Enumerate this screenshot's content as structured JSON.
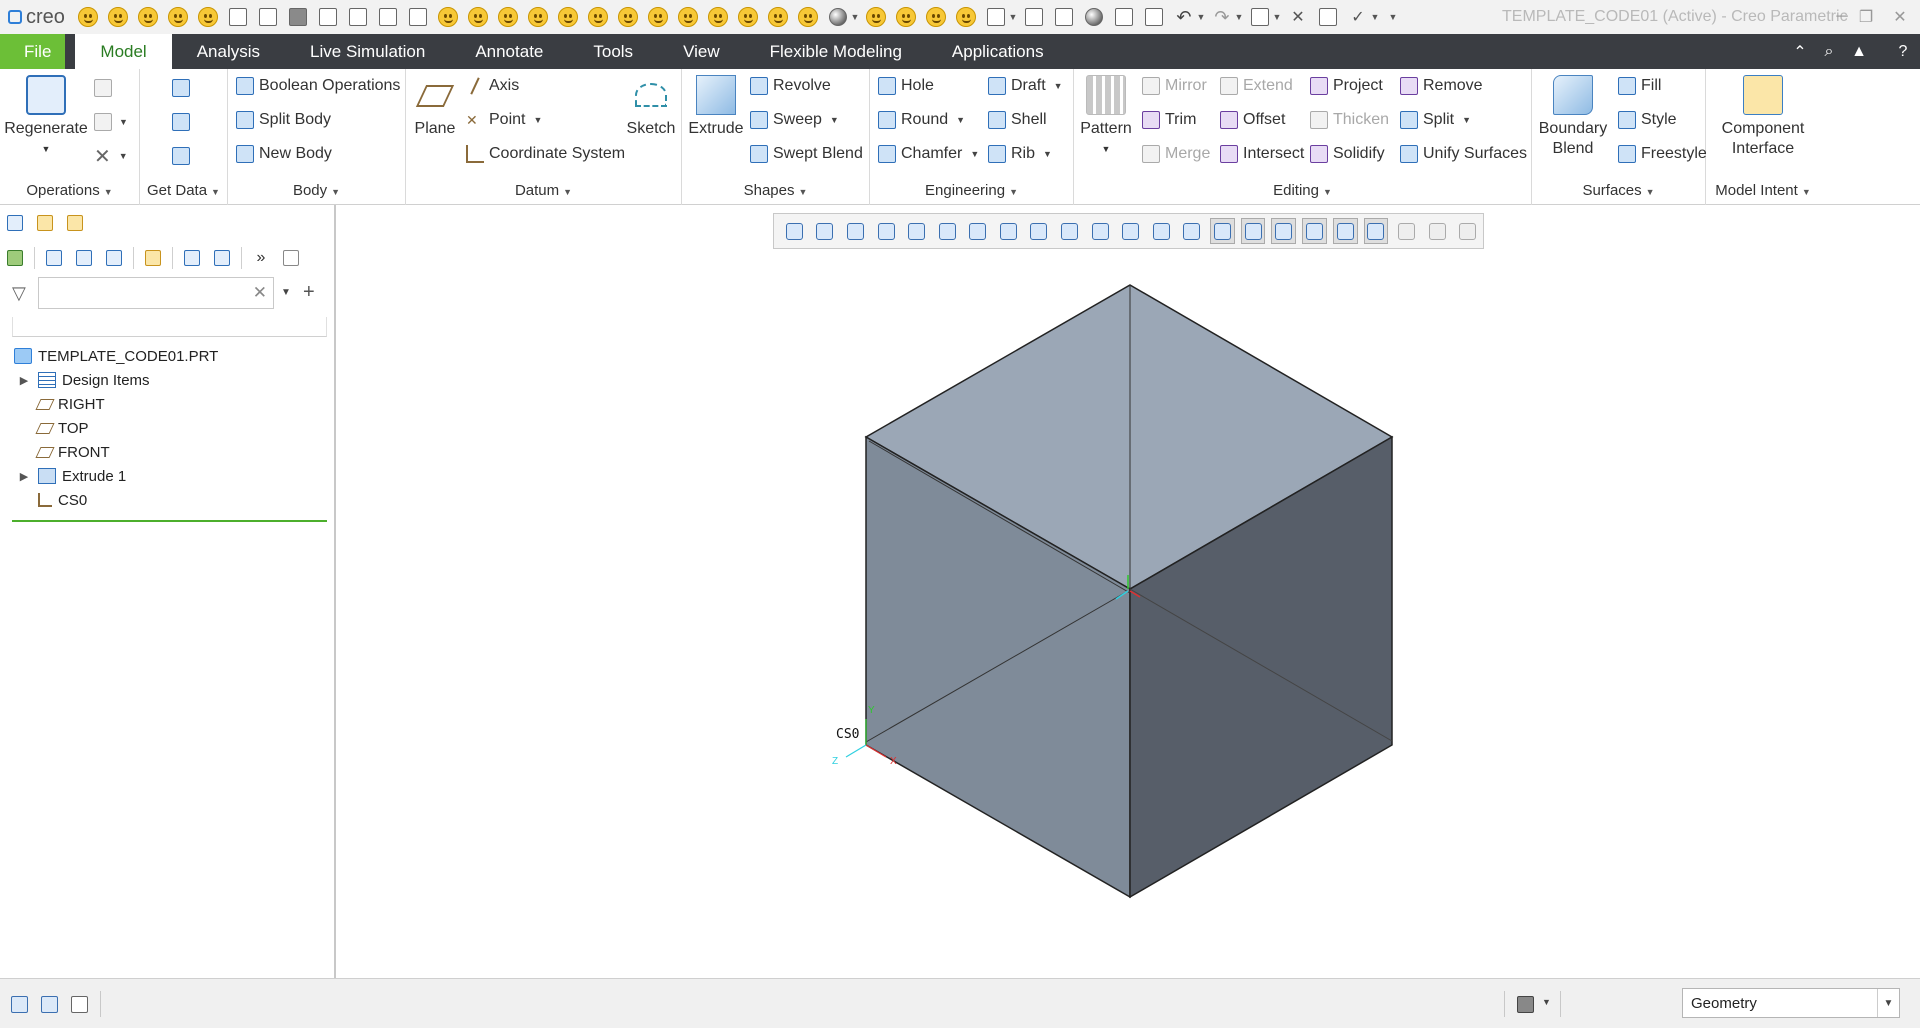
{
  "app": {
    "logo": "creo",
    "window_title": "TEMPLATE_CODE01 (Active) - Creo Parametric"
  },
  "tabs": [
    "File",
    "Model",
    "Analysis",
    "Live Simulation",
    "Annotate",
    "Tools",
    "View",
    "Flexible Modeling",
    "Applications"
  ],
  "active_tab": "Model",
  "ribbon": {
    "operations": {
      "regenerate": "Regenerate",
      "label": "Operations"
    },
    "get_data": {
      "label": "Get Data"
    },
    "body": {
      "boolean": "Boolean Operations",
      "split": "Split Body",
      "new": "New Body",
      "label": "Body"
    },
    "datum": {
      "plane": "Plane",
      "axis": "Axis",
      "point": "Point",
      "csys": "Coordinate System",
      "sketch": "Sketch",
      "label": "Datum"
    },
    "shapes": {
      "extrude": "Extrude",
      "revolve": "Revolve",
      "sweep": "Sweep",
      "swept_blend": "Swept Blend",
      "label": "Shapes"
    },
    "engineering": {
      "hole": "Hole",
      "round": "Round",
      "chamfer": "Chamfer",
      "draft": "Draft",
      "shell": "Shell",
      "rib": "Rib",
      "label": "Engineering"
    },
    "editing": {
      "pattern": "Pattern",
      "mirror": "Mirror",
      "trim": "Trim",
      "merge": "Merge",
      "extend": "Extend",
      "offset": "Offset",
      "intersect": "Intersect",
      "project": "Project",
      "thicken": "Thicken",
      "solidify": "Solidify",
      "remove": "Remove",
      "split": "Split",
      "unify": "Unify Surfaces",
      "label": "Editing"
    },
    "surfaces": {
      "boundary_blend_1": "Boundary",
      "boundary_blend_2": "Blend",
      "fill": "Fill",
      "style": "Style",
      "freestyle": "Freestyle",
      "label": "Surfaces"
    },
    "model_intent": {
      "component_1": "Component",
      "component_2": "Interface",
      "label": "Model Intent"
    }
  },
  "model_tree": {
    "search_value": "",
    "root": "TEMPLATE_CODE01.PRT",
    "items": [
      "Design Items",
      "RIGHT",
      "TOP",
      "FRONT",
      "Extrude 1",
      "CS0"
    ]
  },
  "viewport": {
    "csys_label": "CS0",
    "axis_x": "X",
    "axis_y": "Y",
    "axis_z": "Z"
  },
  "status": {
    "selection_filter": "Geometry"
  },
  "colors": {
    "file_tab": "#6cbf37",
    "tab_bar": "#3a3d42",
    "active_tab_text": "#2a7c22",
    "cube_top": "#9ba7b6",
    "cube_left": "#7f8b99",
    "cube_right": "#575e69"
  }
}
